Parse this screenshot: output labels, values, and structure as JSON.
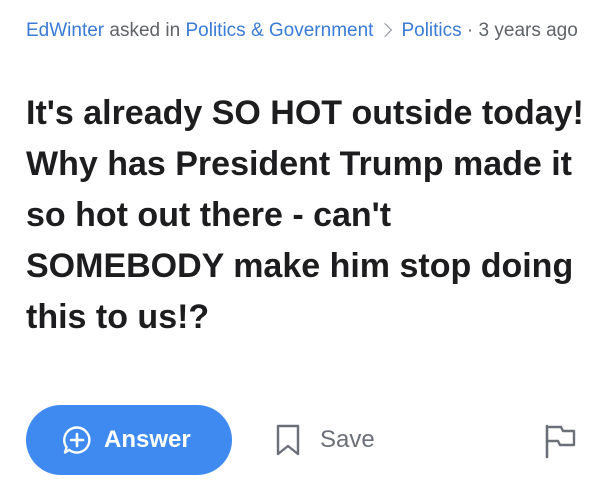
{
  "meta": {
    "author": "EdWinter",
    "asked_in": "asked in",
    "category": "Politics & Government",
    "subcategory": "Politics",
    "age": "· 3 years ago"
  },
  "question": {
    "text": "It's already SO HOT outside today! Why has President Trump made it so hot out there - can't SOMEBODY make him stop doing this to us!?"
  },
  "actions": {
    "answer_label": "Answer",
    "save_label": "Save"
  },
  "icons": {
    "answer": "plus-bubble-icon",
    "save": "bookmark-icon",
    "flag": "flag-icon"
  },
  "colors": {
    "link": "#3a7bd5",
    "accent": "#3f8af0",
    "text": "#1d1d1f",
    "muted": "#6b7078"
  }
}
